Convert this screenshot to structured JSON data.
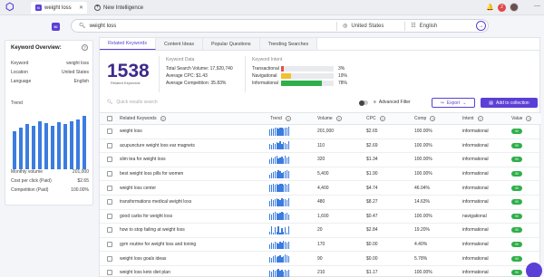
{
  "topbar": {
    "tab_active_badge": "KI",
    "tab_active_label": "weight loss",
    "tab_new_label": "New Intelligence",
    "notifications": "2"
  },
  "search": {
    "badge": "KI",
    "keyword": "weight loss",
    "location": "United States",
    "language": "English"
  },
  "overview": {
    "title": "Keyword Overview:",
    "rows": [
      {
        "label": "Keyword",
        "value": "weight loss"
      },
      {
        "label": "Location",
        "value": "United States"
      },
      {
        "label": "Language",
        "value": "English"
      }
    ],
    "trend_label": "Trend",
    "trend_values": [
      0.67,
      0.74,
      0.81,
      0.78,
      0.86,
      0.82,
      0.78,
      0.84,
      0.8,
      0.86,
      0.88,
      0.95
    ],
    "month_labels": [
      "Jul 22",
      "Aug 22",
      "Sep 22",
      "Oct 22",
      "Nov 22",
      "Dec 22",
      "Jan 23",
      "Feb 23",
      "Mar 23",
      "Apr 23",
      "May 23",
      "Jun 23"
    ],
    "metrics": [
      {
        "label": "Monthly volume",
        "value": "201,000"
      },
      {
        "label": "Cost per click (Paid)",
        "value": "$2.65"
      },
      {
        "label": "Competition (Paid)",
        "value": "100.00%"
      }
    ]
  },
  "tabs": [
    "Related Keywords",
    "Content Ideas",
    "Popular Questions",
    "Trending Searches"
  ],
  "summary": {
    "count": "1538",
    "count_label": "Related Keywords",
    "data_title": "Keyword Data",
    "data_rows": [
      {
        "label": "Total Search Volume:",
        "value": "17,920,740"
      },
      {
        "label": "Average CPC:",
        "value": "$1.43"
      },
      {
        "label": "Average Competition:",
        "value": "35.83%"
      }
    ],
    "intent_title": "Keyword Intent",
    "intents": [
      {
        "name": "Transactional",
        "pct": "3%",
        "fill": 0.06,
        "color": "#e05050"
      },
      {
        "name": "Navigational",
        "pct": "19%",
        "fill": 0.19,
        "color": "#f0c030"
      },
      {
        "name": "Informational",
        "pct": "78%",
        "fill": 0.78,
        "color": "#2eaf4a"
      }
    ]
  },
  "toolbar": {
    "quick_search_placeholder": "Quick results search",
    "advanced_filter": "Advanced Filter",
    "export": "Export",
    "add_collection": "Add to collection"
  },
  "table": {
    "headers": [
      "Related Keywords",
      "Trend",
      "Volume",
      "CPC",
      "Comp",
      "Intent",
      "Value"
    ],
    "rows": [
      {
        "keyword": "weight loss",
        "volume": "201,000",
        "cpc": "$2.65",
        "comp": "100.00%",
        "intent": "informational",
        "value": "90",
        "trend": [
          7,
          8,
          8,
          9,
          9,
          8,
          9,
          9,
          8,
          9,
          9,
          10
        ]
      },
      {
        "keyword": "acupuncture weight loss ear magnets",
        "volume": "110",
        "cpc": "$2.69",
        "comp": "100.00%",
        "intent": "informational",
        "value": "90",
        "trend": [
          6,
          5,
          7,
          6,
          8,
          7,
          9,
          6,
          8,
          7,
          6,
          9
        ]
      },
      {
        "keyword": "slim tea for weight loss",
        "volume": "320",
        "cpc": "$1.34",
        "comp": "100.00%",
        "intent": "informational",
        "value": "90",
        "trend": [
          5,
          7,
          6,
          8,
          9,
          6,
          7,
          8,
          6,
          9,
          7,
          8
        ]
      },
      {
        "keyword": "best weight loss pills for women",
        "volume": "5,400",
        "cpc": "$1.90",
        "comp": "100.00%",
        "intent": "informational",
        "value": "90",
        "trend": [
          4,
          6,
          7,
          8,
          7,
          9,
          8,
          6,
          7,
          8,
          9,
          8
        ]
      },
      {
        "keyword": "weight loss center",
        "volume": "4,400",
        "cpc": "$4.74",
        "comp": "46.04%",
        "intent": "informational",
        "value": "90",
        "trend": [
          8,
          8,
          9,
          8,
          9,
          8,
          9,
          9,
          8,
          9,
          8,
          9
        ]
      },
      {
        "keyword": "transformations medical weight loss",
        "volume": "480",
        "cpc": "$8.27",
        "comp": "14.63%",
        "intent": "informational",
        "value": "90",
        "trend": [
          6,
          8,
          7,
          8,
          9,
          8,
          7,
          9,
          8,
          8,
          7,
          9
        ]
      },
      {
        "keyword": "good carbs for weight loss",
        "volume": "1,600",
        "cpc": "$0.47",
        "comp": "100.00%",
        "intent": "navigational",
        "value": "90",
        "trend": [
          7,
          6,
          8,
          9,
          8,
          7,
          8,
          9,
          8,
          7,
          8,
          6
        ]
      },
      {
        "keyword": "how to stop failing at weight loss",
        "volume": "20",
        "cpc": "$2.84",
        "comp": "19.20%",
        "intent": "informational",
        "value": "90",
        "trend": [
          3,
          9,
          2,
          8,
          3,
          9,
          2,
          7,
          3,
          8,
          2,
          9
        ]
      },
      {
        "keyword": "gym routine for weight loss and toning",
        "volume": "170",
        "cpc": "$0.00",
        "comp": "4.40%",
        "intent": "informational",
        "value": "90",
        "trend": [
          5,
          7,
          6,
          8,
          7,
          6,
          8,
          7,
          9,
          8,
          7,
          8
        ]
      },
      {
        "keyword": "weight loss goals ideas",
        "volume": "90",
        "cpc": "$0.00",
        "comp": "5.78%",
        "intent": "informational",
        "value": "90",
        "trend": [
          6,
          5,
          7,
          8,
          6,
          7,
          8,
          6,
          7,
          9,
          8,
          7
        ]
      },
      {
        "keyword": "weight loss keto diet plan",
        "volume": "210",
        "cpc": "$1.17",
        "comp": "100.00%",
        "intent": "informational",
        "value": "90",
        "trend": [
          7,
          6,
          8,
          7,
          8,
          9,
          7,
          8,
          6,
          8,
          7,
          8
        ]
      }
    ]
  }
}
